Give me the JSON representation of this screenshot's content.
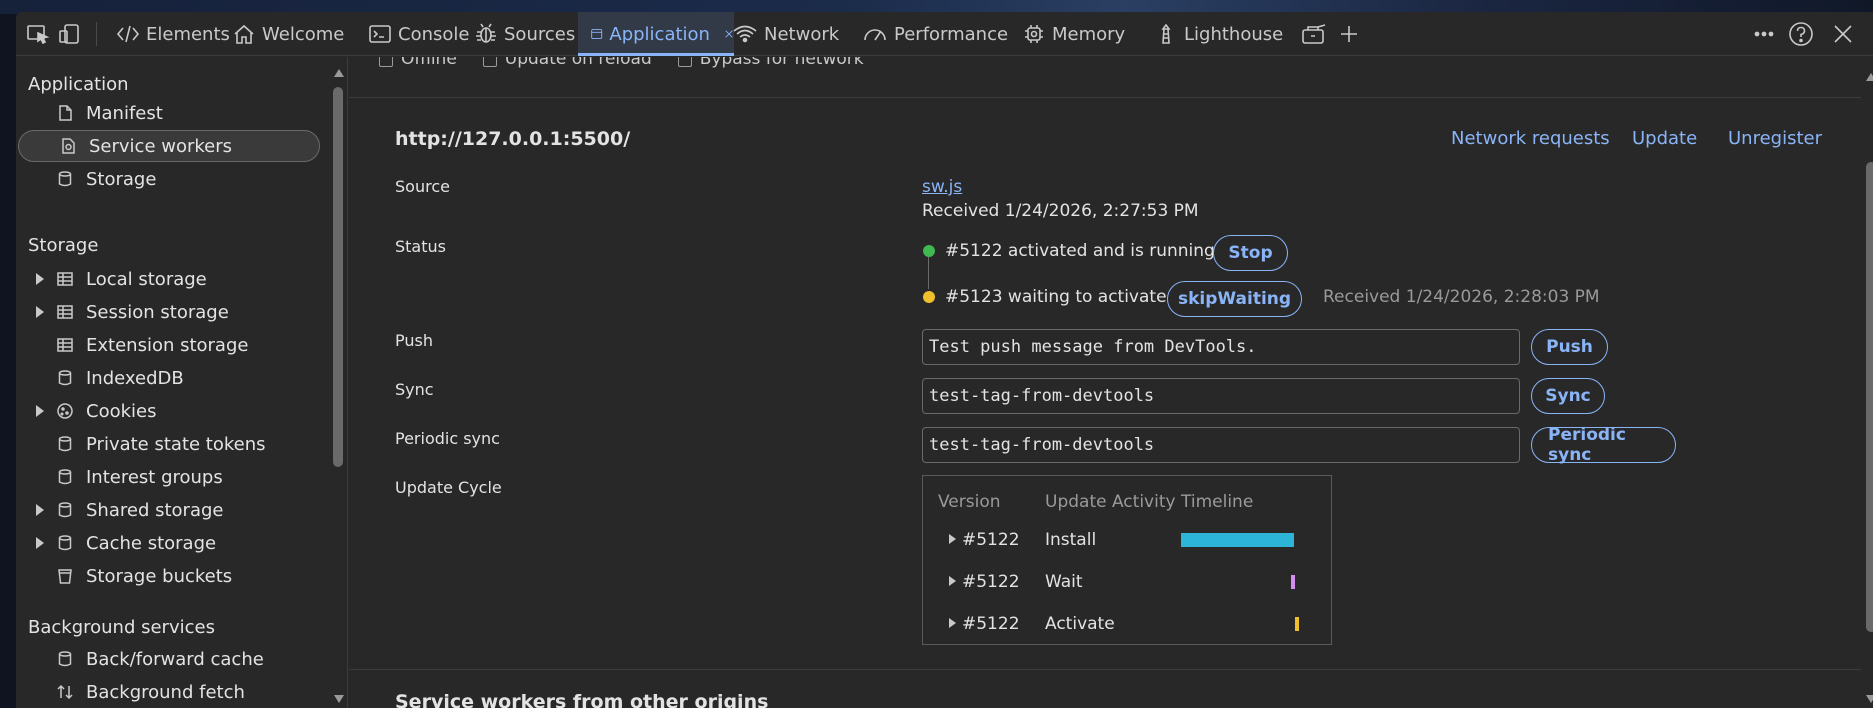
{
  "toolbar": {
    "tabs": [
      {
        "label": "Elements",
        "icon": "code-icon"
      },
      {
        "label": "Welcome",
        "icon": "home-icon"
      },
      {
        "label": "Console",
        "icon": "console-icon"
      },
      {
        "label": "Sources",
        "icon": "bug-icon"
      },
      {
        "label": "Application",
        "icon": "window-icon",
        "active": true
      },
      {
        "label": "Network",
        "icon": "wifi-icon"
      },
      {
        "label": "Performance",
        "icon": "gauge-icon"
      },
      {
        "label": "Memory",
        "icon": "chip-icon"
      },
      {
        "label": "Lighthouse",
        "icon": "lighthouse-icon"
      }
    ]
  },
  "sidebar": {
    "section_application": "Application",
    "application_items": [
      "Manifest",
      "Service workers",
      "Storage"
    ],
    "section_storage": "Storage",
    "storage_items": [
      "Local storage",
      "Session storage",
      "Extension storage",
      "IndexedDB",
      "Cookies",
      "Private state tokens",
      "Interest groups",
      "Shared storage",
      "Cache storage",
      "Storage buckets"
    ],
    "section_background": "Background services",
    "background_items": [
      "Back/forward cache",
      "Background fetch"
    ]
  },
  "main": {
    "top_checkboxes": [
      "Offline",
      "Update on reload",
      "Bypass for network"
    ],
    "origin": "http://127.0.0.1:5500/",
    "actions": {
      "network_requests": "Network requests",
      "update": "Update",
      "unregister": "Unregister"
    },
    "labels": {
      "source": "Source",
      "status": "Status",
      "push": "Push",
      "sync": "Sync",
      "periodic_sync": "Periodic sync",
      "update_cycle": "Update Cycle"
    },
    "source": {
      "file": "sw.js",
      "received": "Received 1/24/2026, 2:27:53 PM"
    },
    "status": {
      "running_text": "#5122 activated and is running",
      "stop_label": "Stop",
      "waiting_text": "#5123 waiting to activate",
      "skip_label": "skipWaiting",
      "waiting_received": "Received 1/24/2026, 2:28:03 PM"
    },
    "push": {
      "value": "Test push message from DevTools.",
      "button": "Push"
    },
    "sync": {
      "value": "test-tag-from-devtools",
      "button": "Sync"
    },
    "periodic_sync": {
      "value": "test-tag-from-devtools",
      "button": "Periodic sync"
    },
    "update_cycle": {
      "headers": [
        "Version",
        "Update Activity",
        "Timeline"
      ],
      "rows": [
        {
          "version": "#5122",
          "activity": "Install",
          "color": "#2cb5d9"
        },
        {
          "version": "#5122",
          "activity": "Wait",
          "color": "#d68df0"
        },
        {
          "version": "#5122",
          "activity": "Activate",
          "color": "#f0c02c"
        }
      ]
    },
    "other_origins_title": "Service workers from other origins"
  },
  "colors": {
    "accent": "#8ab4f8",
    "running": "#3fb950",
    "waiting": "#f0c02c"
  }
}
